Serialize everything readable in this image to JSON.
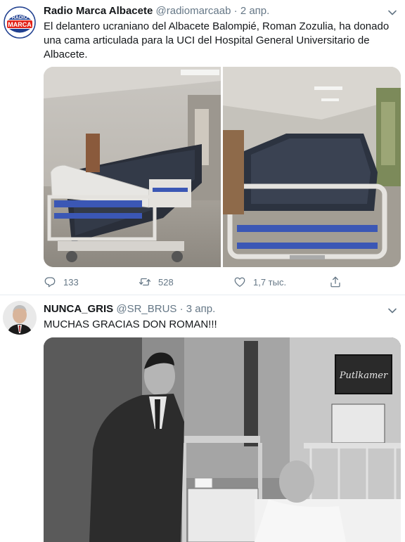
{
  "tweets": [
    {
      "author_name": "Radio Marca Albacete",
      "author_handle": "@radiomarcaab",
      "separator": "·",
      "date": "2 апр.",
      "avatar_logo_text": "RADIO MARCA",
      "text": "El delantero ucraniano del Albacete Balompié, Roman Zozulia, ha donado una cama articulada para la UCI del Hospital General Universitario de Albacete.",
      "actions": {
        "reply_count": "133",
        "retweet_count": "528",
        "like_count": "1,7 тыс."
      },
      "icons": [
        "radio-marca-logo",
        "chevron-down-icon",
        "reply-icon",
        "retweet-icon",
        "heart-icon",
        "share-icon"
      ]
    },
    {
      "author_name": "NUNCA_GRIS",
      "author_handle": "@SR_BRUS",
      "separator": "·",
      "date": "3 апр.",
      "text": "MUCHAS GRACIAS DON ROMAN!!!",
      "photo_sign_text": "Putlkamer",
      "icons": [
        "chevron-down-icon"
      ]
    }
  ],
  "colors": {
    "text_primary": "#14171a",
    "text_secondary": "#657786",
    "divider": "#e6ecf0",
    "logo_blue": "#1f3f8f",
    "logo_red": "#e2231a"
  }
}
